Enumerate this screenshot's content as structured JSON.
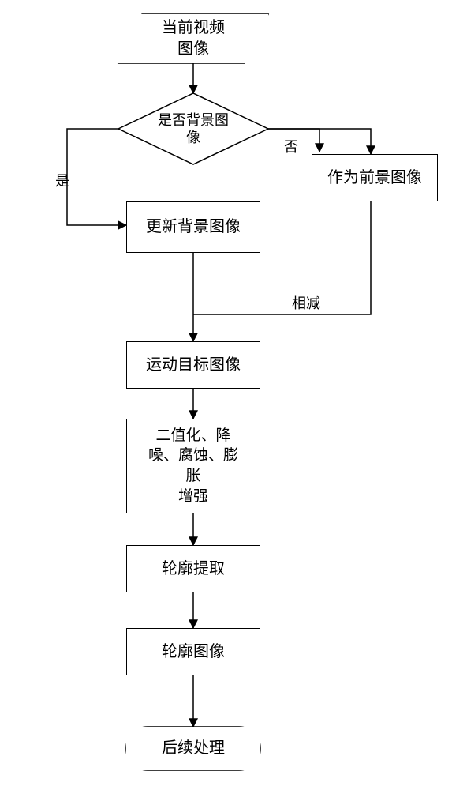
{
  "chart_data": {
    "type": "flowchart",
    "nodes": [
      {
        "id": "start",
        "shape": "parallelogram",
        "label": "当前视频\n图像"
      },
      {
        "id": "dec",
        "shape": "diamond",
        "label": "是否背景图\n像"
      },
      {
        "id": "fg",
        "shape": "rect",
        "label": "作为前景图像"
      },
      {
        "id": "upd",
        "shape": "rect",
        "label": "更新背景图像"
      },
      {
        "id": "moving",
        "shape": "rect",
        "label": "运动目标图像"
      },
      {
        "id": "morph",
        "shape": "rect",
        "label": "二值化、降\n噪、腐蚀、膨\n胀\n增强"
      },
      {
        "id": "contour",
        "shape": "rect",
        "label": "轮廓提取"
      },
      {
        "id": "cimg",
        "shape": "rect",
        "label": "轮廓图像"
      },
      {
        "id": "end",
        "shape": "terminator",
        "label": "后续处理"
      }
    ],
    "edges": [
      {
        "from": "start",
        "to": "dec"
      },
      {
        "from": "dec",
        "to": "upd",
        "label": "是",
        "label_id": "yes"
      },
      {
        "from": "dec",
        "to": "fg",
        "label": "否",
        "label_id": "no"
      },
      {
        "from": "upd",
        "to": "moving"
      },
      {
        "from": "fg",
        "to": "moving",
        "label": "相减",
        "label_id": "sub",
        "op": "subtract"
      },
      {
        "from": "moving",
        "to": "morph"
      },
      {
        "from": "morph",
        "to": "contour"
      },
      {
        "from": "contour",
        "to": "cimg"
      },
      {
        "from": "cimg",
        "to": "end"
      }
    ]
  }
}
